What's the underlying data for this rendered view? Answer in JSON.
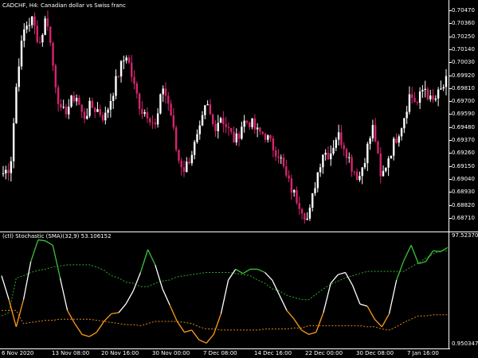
{
  "window": {
    "symbol_title": "CADCHF, H4:  Canadian dollar vs Swiss franc"
  },
  "indicator": {
    "title": "(ctl) Stochastic (SMA)(32,9) 53.106152",
    "scale_top": "97.523704",
    "scale_bottom": "0.950347"
  },
  "price_axis": [
    "0.70470",
    "0.70360",
    "0.70250",
    "0.70140",
    "0.70030",
    "0.69920",
    "0.69810",
    "0.69700",
    "0.69590",
    "0.69480",
    "0.69370",
    "0.69260",
    "0.69150",
    "0.69040",
    "0.68930",
    "0.68820",
    "0.68710"
  ],
  "time_axis": [
    "6 Nov 2020",
    "13 Nov 08:00",
    "20 Nov 16:00",
    "30 Nov 00:00",
    "7 Dec 08:00",
    "14 Dec 16:00",
    "22 Dec 00:00",
    "30 Dec 08:00",
    "7 Jan 16:00"
  ],
  "colors": {
    "background": "#000000",
    "bull_candle": "#ffffff",
    "bear_candle": "#d6246e",
    "stoch_up": "#3cc23c",
    "stoch_down": "#ff9c1a",
    "stoch_neutral": "#ffffff",
    "signal_green": "#2ea82e",
    "signal_orange": "#e0861a"
  },
  "chart_data": [
    {
      "type": "candlestick",
      "title": "CADCHF, H4:  Canadian dollar vs Swiss franc",
      "ylim": [
        0.6866,
        0.7054
      ],
      "x": [
        "6 Nov 2020",
        "13 Nov 08:00",
        "20 Nov 16:00",
        "30 Nov 00:00",
        "7 Dec 08:00",
        "14 Dec 16:00",
        "22 Dec 00:00",
        "30 Dec 08:00",
        "7 Jan 16:00"
      ],
      "close_path": [
        0.6912,
        0.6918,
        0.7,
        0.7035,
        0.704,
        0.702,
        0.7045,
        0.6995,
        0.696,
        0.6968,
        0.6978,
        0.6958,
        0.6968,
        0.6965,
        0.6958,
        0.6978,
        0.6998,
        0.7012,
        0.6985,
        0.6965,
        0.6962,
        0.695,
        0.6985,
        0.6965,
        0.6925,
        0.6915,
        0.693,
        0.6945,
        0.697,
        0.695,
        0.696,
        0.6948,
        0.6938,
        0.6955,
        0.6955,
        0.6946,
        0.6945,
        0.6935,
        0.6928,
        0.6908,
        0.6895,
        0.6885,
        0.6872,
        0.6905,
        0.693,
        0.6928,
        0.6945,
        0.6935,
        0.6918,
        0.6908,
        0.693,
        0.6952,
        0.6906,
        0.6925,
        0.694,
        0.6955,
        0.6978,
        0.697,
        0.6985,
        0.697,
        0.6978,
        0.6988
      ]
    },
    {
      "type": "line",
      "title": "(ctl) Stochastic (SMA)(32,9) 53.106152",
      "ylim": [
        0.950347,
        97.523704
      ],
      "series": [
        {
          "values": [
            62,
            40,
            15,
            40,
            75,
            95,
            94,
            90,
            60,
            30,
            18,
            8,
            6,
            10,
            20,
            27,
            28,
            36,
            48,
            65,
            86,
            72,
            50,
            35,
            20,
            10,
            12,
            3,
            0,
            8,
            27,
            58,
            68,
            64,
            68,
            68,
            65,
            58,
            44,
            30,
            22,
            12,
            8,
            10,
            28,
            55,
            63,
            65,
            53,
            36,
            34,
            22,
            15,
            27,
            58,
            76,
            90,
            73,
            75,
            85,
            84,
            88
          ]
        },
        {
          "values": [
            30,
            30,
            30,
            18,
            19,
            20,
            21,
            21,
            22,
            22,
            22,
            22,
            22,
            21,
            20,
            19,
            18,
            17,
            17,
            16,
            18,
            20,
            20,
            20,
            20,
            19,
            18,
            15,
            13,
            13,
            12,
            12,
            12,
            12,
            12,
            12,
            13,
            13,
            13,
            13,
            14,
            14,
            16,
            16,
            16,
            16,
            16,
            16,
            16,
            16,
            15,
            15,
            13,
            12,
            15,
            19,
            22,
            25,
            25,
            26,
            26,
            26
          ]
        },
        {
          "values": [
            25,
            28,
            60,
            62,
            65,
            67,
            68,
            70,
            71,
            72,
            72,
            72,
            72,
            70,
            67,
            62,
            60,
            56,
            55,
            52,
            52,
            55,
            57,
            58,
            61,
            62,
            63,
            64,
            65,
            65,
            65,
            65,
            64,
            63,
            62,
            58,
            55,
            50,
            48,
            44,
            42,
            40,
            40,
            45,
            50,
            54,
            57,
            60,
            62,
            64,
            66,
            66,
            66,
            66,
            66,
            66,
            70,
            74,
            78,
            82,
            85,
            85
          ]
        }
      ]
    }
  ]
}
